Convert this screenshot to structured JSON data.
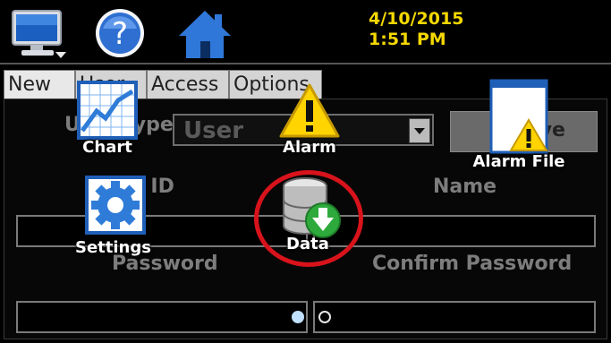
{
  "topbar": {
    "icons": [
      "monitor-icon",
      "help-icon",
      "home-icon"
    ],
    "date": "4/10/2015",
    "time": "1:51 PM",
    "datetime_color": "#f5d800"
  },
  "tabs": [
    {
      "label": "New"
    },
    {
      "label": "User"
    },
    {
      "label": "Access"
    },
    {
      "label": "Options"
    }
  ],
  "form": {
    "user_type_label": "User Type",
    "user_type_value": "User",
    "save_label": "Save",
    "user_id_label": "User ID",
    "name_label": "Name",
    "password_label": "Password",
    "confirm_password_label": "Confirm Password"
  },
  "launcher": {
    "items": [
      {
        "label": "Chart",
        "icon": "chart-icon"
      },
      {
        "label": "Alarm",
        "icon": "alarm-warning-icon"
      },
      {
        "label": "Alarm File",
        "icon": "alarm-file-icon"
      },
      {
        "label": "Settings",
        "icon": "settings-gear-icon"
      },
      {
        "label": "Data",
        "icon": "database-download-icon"
      }
    ],
    "highlight_color": "#d8131b"
  },
  "pager": {
    "pages": 2,
    "current": 1
  }
}
